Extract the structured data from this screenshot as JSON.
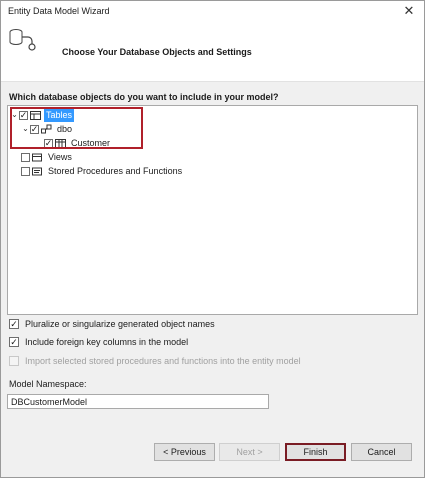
{
  "window": {
    "title": "Entity Data Model Wizard"
  },
  "header": {
    "title": "Choose Your Database Objects and Settings"
  },
  "tree": {
    "question": "Which database objects do you want to include in your model?",
    "nodes": {
      "tables": "Tables",
      "dbo": "dbo",
      "customer": "Customer",
      "views": "Views",
      "procs": "Stored Procedures and Functions"
    }
  },
  "options": {
    "pluralize": "Pluralize or singularize generated object names",
    "foreign_keys": "Include foreign key columns in the model",
    "import_procs": "Import selected stored procedures and functions into the entity model"
  },
  "namespace": {
    "label": "Model Namespace:",
    "value": "DBCustomerModel"
  },
  "buttons": {
    "previous": "< Previous",
    "next": "Next >",
    "finish": "Finish",
    "cancel": "Cancel"
  },
  "colors": {
    "selection": "#3399ff",
    "highlight": "#b0202a"
  }
}
